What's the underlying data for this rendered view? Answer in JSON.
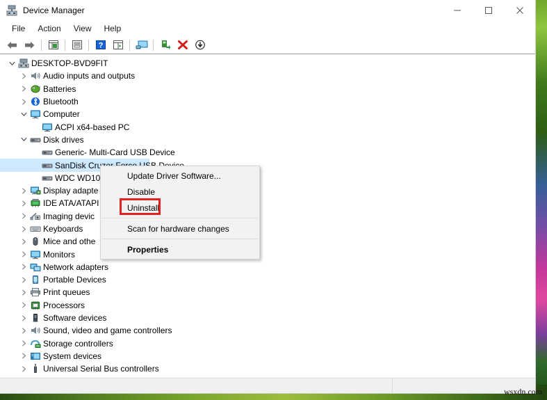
{
  "window": {
    "title": "Device Manager",
    "icon": "device-manager-icon",
    "controls": {
      "minimize": "—",
      "maximize": "□",
      "close": "✕"
    }
  },
  "menubar": {
    "items": [
      "File",
      "Action",
      "View",
      "Help"
    ]
  },
  "toolbar": {
    "buttons": [
      {
        "name": "back-icon",
        "glyph": "⬅"
      },
      {
        "name": "forward-icon",
        "glyph": "➡"
      },
      {
        "name": "properties-icon",
        "glyph": "▤"
      },
      {
        "name": "update-driver-icon",
        "glyph": "▣"
      },
      {
        "name": "help-icon",
        "glyph": "?"
      },
      {
        "name": "show-hidden-devices-icon",
        "glyph": "▥"
      },
      {
        "name": "scan-hardware-icon",
        "glyph": "Ὓ5"
      },
      {
        "name": "enable-device-icon",
        "glyph": "↳"
      },
      {
        "name": "uninstall-device-icon",
        "glyph": "✕"
      },
      {
        "name": "disable-device-icon",
        "glyph": "↓"
      }
    ]
  },
  "tree": {
    "items": [
      {
        "label": "DESKTOP-BVD9FIT",
        "indent": 0,
        "twisty": "expanded",
        "icon": "computer-root-icon",
        "selected": false
      },
      {
        "label": "Audio inputs and outputs",
        "indent": 1,
        "twisty": "collapsed",
        "icon": "speaker-icon",
        "selected": false
      },
      {
        "label": "Batteries",
        "indent": 1,
        "twisty": "collapsed",
        "icon": "battery-icon",
        "selected": false
      },
      {
        "label": "Bluetooth",
        "indent": 1,
        "twisty": "collapsed",
        "icon": "bluetooth-icon",
        "selected": false
      },
      {
        "label": "Computer",
        "indent": 1,
        "twisty": "expanded",
        "icon": "monitor-icon",
        "selected": false
      },
      {
        "label": "ACPI x64-based PC",
        "indent": 2,
        "twisty": "none",
        "icon": "monitor-icon",
        "selected": false
      },
      {
        "label": "Disk drives",
        "indent": 1,
        "twisty": "expanded",
        "icon": "disk-icon",
        "selected": false
      },
      {
        "label": "Generic- Multi-Card USB Device",
        "indent": 2,
        "twisty": "none",
        "icon": "disk-icon",
        "selected": false
      },
      {
        "label": "SanDisk Cruzer Force USB Device",
        "indent": 2,
        "twisty": "none",
        "icon": "disk-icon",
        "selected": true
      },
      {
        "label": "WDC WD10",
        "indent": 2,
        "twisty": "none",
        "icon": "disk-icon",
        "selected": false
      },
      {
        "label": "Display adapte",
        "indent": 1,
        "twisty": "collapsed",
        "icon": "display-adapter-icon",
        "selected": false
      },
      {
        "label": "IDE ATA/ATAPI",
        "indent": 1,
        "twisty": "collapsed",
        "icon": "ide-controller-icon",
        "selected": false
      },
      {
        "label": "Imaging devic",
        "indent": 1,
        "twisty": "collapsed",
        "icon": "camera-icon",
        "selected": false
      },
      {
        "label": "Keyboards",
        "indent": 1,
        "twisty": "collapsed",
        "icon": "keyboard-icon",
        "selected": false
      },
      {
        "label": "Mice and othe",
        "indent": 1,
        "twisty": "collapsed",
        "icon": "mouse-icon",
        "selected": false
      },
      {
        "label": "Monitors",
        "indent": 1,
        "twisty": "collapsed",
        "icon": "monitor-icon",
        "selected": false
      },
      {
        "label": "Network adapters",
        "indent": 1,
        "twisty": "collapsed",
        "icon": "network-icon",
        "selected": false
      },
      {
        "label": "Portable Devices",
        "indent": 1,
        "twisty": "collapsed",
        "icon": "portable-device-icon",
        "selected": false
      },
      {
        "label": "Print queues",
        "indent": 1,
        "twisty": "collapsed",
        "icon": "printer-icon",
        "selected": false
      },
      {
        "label": "Processors",
        "indent": 1,
        "twisty": "collapsed",
        "icon": "processor-icon",
        "selected": false
      },
      {
        "label": "Software devices",
        "indent": 1,
        "twisty": "collapsed",
        "icon": "software-device-icon",
        "selected": false
      },
      {
        "label": "Sound, video and game controllers",
        "indent": 1,
        "twisty": "collapsed",
        "icon": "speaker-icon",
        "selected": false
      },
      {
        "label": "Storage controllers",
        "indent": 1,
        "twisty": "collapsed",
        "icon": "storage-controller-icon",
        "selected": false
      },
      {
        "label": "System devices",
        "indent": 1,
        "twisty": "collapsed",
        "icon": "system-device-icon",
        "selected": false
      },
      {
        "label": "Universal Serial Bus controllers",
        "indent": 1,
        "twisty": "collapsed",
        "icon": "usb-icon",
        "selected": false
      }
    ]
  },
  "context_menu": {
    "items": [
      {
        "label": "Update Driver Software...",
        "bold": false,
        "highlighted": false,
        "separator_before": false
      },
      {
        "label": "Disable",
        "bold": false,
        "highlighted": false,
        "separator_before": false
      },
      {
        "label": "Uninstall",
        "bold": false,
        "highlighted": true,
        "separator_before": false
      },
      {
        "label": "Scan for hardware changes",
        "bold": false,
        "highlighted": false,
        "separator_before": true
      },
      {
        "label": "Properties",
        "bold": true,
        "highlighted": false,
        "separator_before": true
      }
    ],
    "highlight_color": "#e41f1f"
  },
  "statusbar": {
    "left_text": "",
    "right_text": ""
  },
  "watermark": {
    "text": "wsxdn.com"
  },
  "colors": {
    "selection": "#cde8ff",
    "highlight_box": "#e41f1f",
    "menu_bg": "#f2f2f2",
    "window_bg": "#ffffff"
  }
}
